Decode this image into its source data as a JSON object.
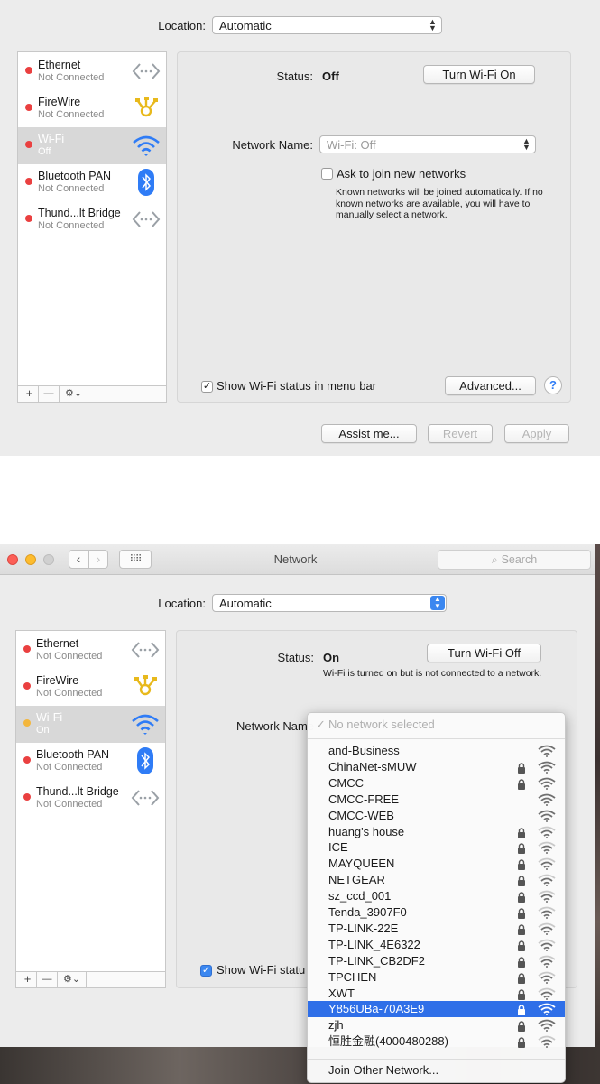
{
  "window1": {
    "location_label": "Location:",
    "location_value": "Automatic",
    "sidebar": [
      {
        "name": "Ethernet",
        "status": "Not Connected",
        "icon": "ethernet-icon",
        "dot": "red"
      },
      {
        "name": "FireWire",
        "status": "Not Connected",
        "icon": "firewire-icon",
        "dot": "red"
      },
      {
        "name": "Wi-Fi",
        "status": "Off",
        "icon": "wifi-icon",
        "dot": "red",
        "selected": true
      },
      {
        "name": "Bluetooth PAN",
        "status": "Not Connected",
        "icon": "bluetooth-icon",
        "dot": "red"
      },
      {
        "name": "Thund...lt Bridge",
        "status": "Not Connected",
        "icon": "thunderbolt-bridge-icon",
        "dot": "red"
      }
    ],
    "toolbar": {
      "add": "+",
      "remove": "—",
      "gear": "⚙︎⌄"
    },
    "status_label": "Status:",
    "status_value": "Off",
    "toggle_button": "Turn Wi-Fi On",
    "network_name_label": "Network Name:",
    "network_name_value": "Wi-Fi: Off",
    "ask_join_label": "Ask to join new networks",
    "ask_join_help": "Known networks will be joined automatically. If no known networks are available, you will have to manually select a network.",
    "show_status_label": "Show Wi-Fi status in menu bar",
    "advanced_button": "Advanced...",
    "help_button": "?",
    "assist_button": "Assist me...",
    "revert_button": "Revert",
    "apply_button": "Apply"
  },
  "window2": {
    "title": "Network",
    "search_placeholder": "Search",
    "location_label": "Location:",
    "location_value": "Automatic",
    "sidebar": [
      {
        "name": "Ethernet",
        "status": "Not Connected",
        "icon": "ethernet-icon",
        "dot": "red"
      },
      {
        "name": "FireWire",
        "status": "Not Connected",
        "icon": "firewire-icon",
        "dot": "red"
      },
      {
        "name": "Wi-Fi",
        "status": "On",
        "icon": "wifi-icon",
        "dot": "amber",
        "selected": true
      },
      {
        "name": "Bluetooth PAN",
        "status": "Not Connected",
        "icon": "bluetooth-icon",
        "dot": "red"
      },
      {
        "name": "Thund...lt Bridge",
        "status": "Not Connected",
        "icon": "thunderbolt-bridge-icon",
        "dot": "red"
      }
    ],
    "toolbar": {
      "add": "+",
      "remove": "—",
      "gear": "⚙︎⌄"
    },
    "status_label": "Status:",
    "status_value": "On",
    "status_detail": "Wi-Fi is turned on but is not connected to a network.",
    "toggle_button": "Turn Wi-Fi Off",
    "network_name_label": "Network Name",
    "show_status_label": "Show Wi-Fi statu",
    "dropdown": {
      "no_network": "No network selected",
      "check": "✓",
      "networks": [
        {
          "name": "and-Business",
          "locked": false,
          "strength": 3
        },
        {
          "name": "ChinaNet-sMUW",
          "locked": true,
          "strength": 3
        },
        {
          "name": "CMCC",
          "locked": true,
          "strength": 3
        },
        {
          "name": "CMCC-FREE",
          "locked": false,
          "strength": 3
        },
        {
          "name": "CMCC-WEB",
          "locked": false,
          "strength": 3
        },
        {
          "name": "huang's house",
          "locked": true,
          "strength": 2
        },
        {
          "name": "ICE",
          "locked": true,
          "strength": 2
        },
        {
          "name": "MAYQUEEN",
          "locked": true,
          "strength": 2
        },
        {
          "name": "NETGEAR",
          "locked": true,
          "strength": 2
        },
        {
          "name": "sz_ccd_001",
          "locked": true,
          "strength": 2
        },
        {
          "name": "Tenda_3907F0",
          "locked": true,
          "strength": 2
        },
        {
          "name": "TP-LINK-22E",
          "locked": true,
          "strength": 2
        },
        {
          "name": "TP-LINK_4E6322",
          "locked": true,
          "strength": 2
        },
        {
          "name": "TP-LINK_CB2DF2",
          "locked": true,
          "strength": 2
        },
        {
          "name": "TPCHEN",
          "locked": true,
          "strength": 2
        },
        {
          "name": "XWT",
          "locked": true,
          "strength": 2
        },
        {
          "name": "Y856UBa-70A3E9",
          "locked": true,
          "strength": 3,
          "highlighted": true
        },
        {
          "name": "zjh",
          "locked": true,
          "strength": 3
        },
        {
          "name": "恒胜金融(4000480288)",
          "locked": true,
          "strength": 2
        }
      ],
      "join_other": "Join Other Network..."
    }
  },
  "colors": {
    "accent": "#2f6fe8",
    "dot_red": "#ea4040",
    "dot_amber": "#f3b63c",
    "wifi_blue": "#2f7cf6"
  }
}
